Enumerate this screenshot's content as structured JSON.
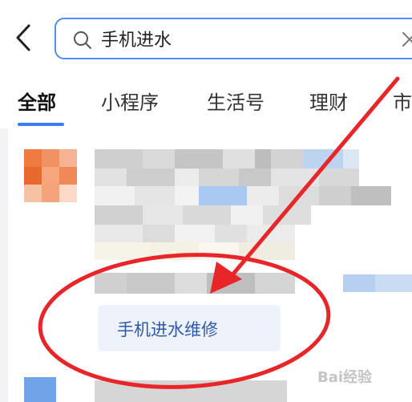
{
  "search": {
    "query": "手机进水",
    "placeholder": ""
  },
  "tabs": [
    {
      "label": "全部",
      "active": true
    },
    {
      "label": "小程序",
      "active": false
    },
    {
      "label": "生活号",
      "active": false
    },
    {
      "label": "理财",
      "active": false
    },
    {
      "label": "市",
      "active": false
    }
  ],
  "results": {
    "suggestion_label": "手机进水维修"
  },
  "annotation": {
    "color": "#e8262a"
  },
  "watermark": {
    "text": "Bai经验"
  },
  "colors": {
    "accent": "#3b7bf6",
    "suggestion_text": "#2e5aa8"
  }
}
